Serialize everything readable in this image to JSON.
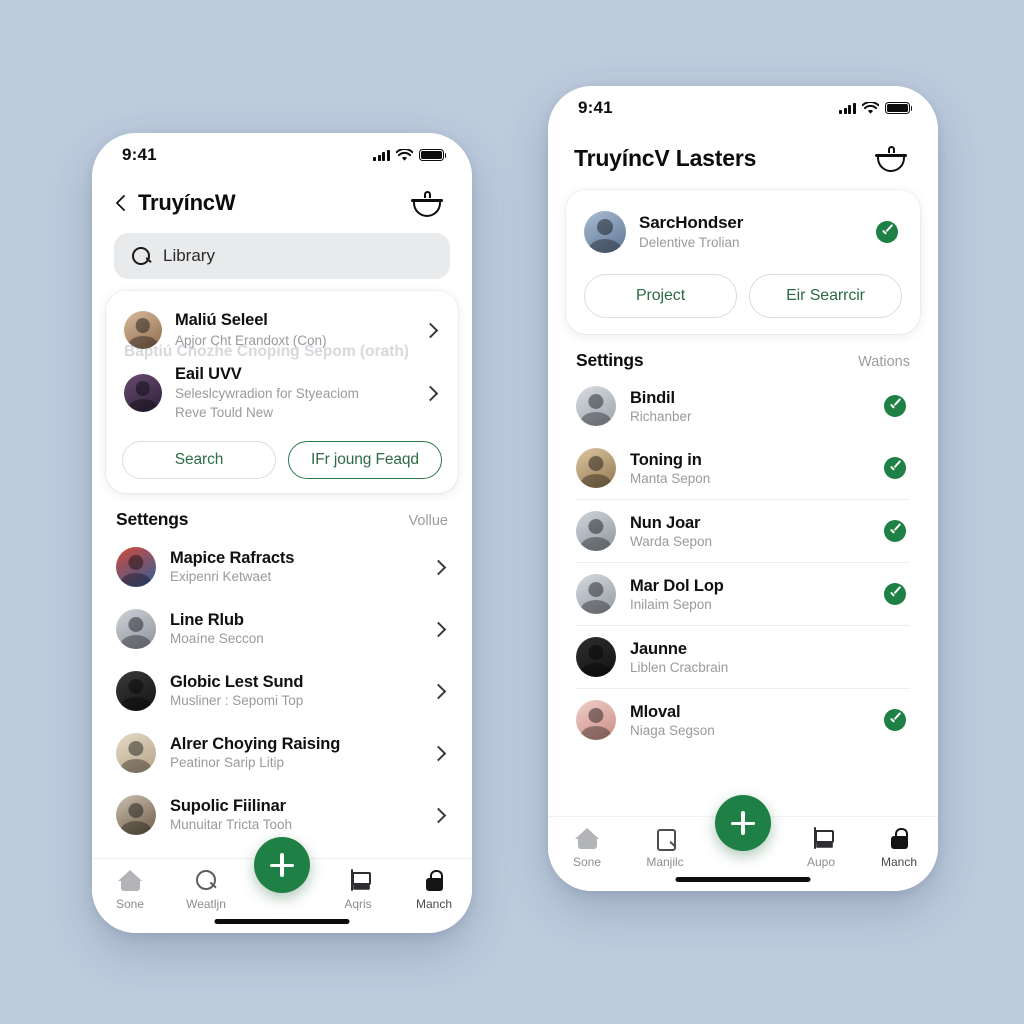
{
  "theme": {
    "accent": "#1e8044",
    "page_bg": "#bdcbdd",
    "muted": "#9a9a9e"
  },
  "left_phone": {
    "status": {
      "time": "9:41",
      "signal_icon": "cellular-bars-icon",
      "wifi_icon": "wifi-icon",
      "battery_icon": "battery-icon"
    },
    "header": {
      "back_icon": "chevron-left-icon",
      "title": "TruyíncW",
      "action_icon": "bowl-icon"
    },
    "search": {
      "icon": "search-icon",
      "value": "Library",
      "placeholder": "Library"
    },
    "card": {
      "ghost_text": "Baptiú Chozhe Cnoping Sepom (orath)",
      "rows": [
        {
          "title": "Maliú Seleel",
          "subtitle": "Apjor Cht Erandoxt (Con)",
          "chevron": "chevron-right-icon",
          "avatar": "avatar-1"
        },
        {
          "title": "Eail UVV",
          "subtitle": "Seleslcywradion for Styeaciom\nReve Tould New",
          "chevron": "chevron-right-icon",
          "avatar": "avatar-2"
        }
      ],
      "buttons": [
        {
          "label": "Search",
          "style": "outline"
        },
        {
          "label": "IFr joung Feaqd",
          "style": "accent"
        }
      ]
    },
    "section": {
      "title": "Settengs",
      "action": "Vollue"
    },
    "list": [
      {
        "title": "Mapice Rafracts",
        "subtitle": "Exipenri Ketwaet",
        "avatar": "avatar-3"
      },
      {
        "title": "Line Rlub",
        "subtitle": "Moaíne Seccon",
        "avatar": "avatar-4"
      },
      {
        "title": "Globic Lest Sund",
        "subtitle": "Musliner : Sepomi Top",
        "avatar": "avatar-5"
      },
      {
        "title": "Alrer Choying Raising",
        "subtitle": "Peatinor Sarip Litip",
        "avatar": "avatar-6"
      },
      {
        "title": "Supolic Fiilinar",
        "subtitle": "Munuitar Tricta Tooh",
        "avatar": "avatar-7"
      }
    ],
    "tabbar": {
      "fab_icon": "plus-icon",
      "items": [
        {
          "label": "Sone",
          "icon": "home-icon",
          "active": false
        },
        {
          "label": "Weatljn",
          "icon": "search-icon",
          "active": false
        },
        {
          "label": "Aqris",
          "icon": "flag-icon",
          "active": false
        },
        {
          "label": "Manch",
          "icon": "lock-icon",
          "active": true
        }
      ]
    }
  },
  "right_phone": {
    "status": {
      "time": "9:41",
      "signal_icon": "cellular-bars-icon",
      "wifi_icon": "wifi-icon",
      "battery_icon": "battery-icon"
    },
    "header": {
      "title": "TruyíncV Lasters",
      "action_icon": "bowl-icon"
    },
    "card": {
      "profile": {
        "title": "SarcHondser",
        "subtitle": "Delentive Trolian",
        "badge": "check-circle-icon",
        "avatar": "avatar-8"
      },
      "buttons": [
        {
          "label": "Project",
          "style": "outline"
        },
        {
          "label": "Eir Searrcir",
          "style": "outline"
        }
      ]
    },
    "section": {
      "title": "Settings",
      "action": "Wations"
    },
    "list": [
      {
        "title": "Bindil",
        "subtitle": "Richanber",
        "avatar": "avatar-9",
        "checked": true
      },
      {
        "title": "Toning in",
        "subtitle": "Manta Sepon",
        "avatar": "avatar-10",
        "checked": true
      },
      {
        "title": "Nun Joar",
        "subtitle": "Warda Sepon",
        "avatar": "avatar-11",
        "checked": true
      },
      {
        "title": "Mar Dol Lop",
        "subtitle": "Inilaim Sepon",
        "avatar": "avatar-12",
        "checked": true
      },
      {
        "title": "Jaunne",
        "subtitle": "Liblen Cracbrain",
        "avatar": "avatar-13",
        "checked": false
      },
      {
        "title": "Mloval",
        "subtitle": "Niaga Segson",
        "avatar": "avatar-14",
        "checked": true
      }
    ],
    "tabbar": {
      "fab_icon": "plus-icon",
      "items": [
        {
          "label": "Sone",
          "icon": "home-icon",
          "active": false
        },
        {
          "label": "Manjilc",
          "icon": "document-icon",
          "active": false
        },
        {
          "label": "Aupo",
          "icon": "flag-icon",
          "active": false
        },
        {
          "label": "Manch",
          "icon": "lock-icon",
          "active": true
        }
      ]
    }
  }
}
